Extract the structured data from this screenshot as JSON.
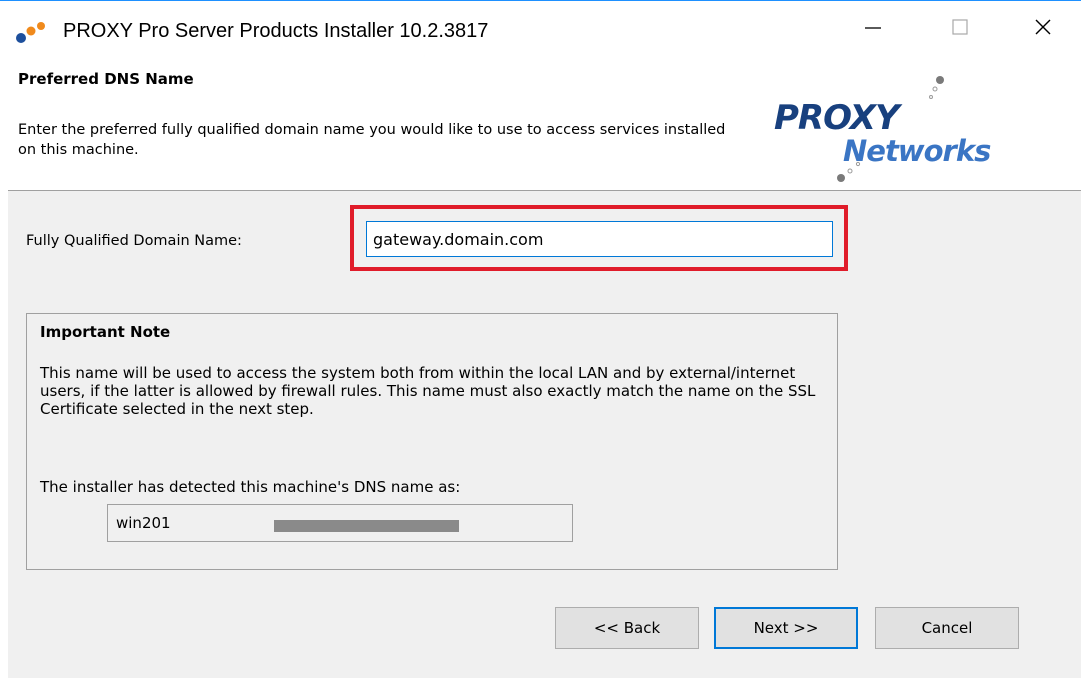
{
  "window": {
    "title": "PROXY Pro Server Products Installer 10.2.3817",
    "icon": "app-icon",
    "controls": [
      "minimize-icon",
      "maximize-icon",
      "close-icon"
    ]
  },
  "header": {
    "title": "Preferred DNS Name",
    "description": "Enter the preferred fully qualified domain name you would like to use to access services installed on this machine.",
    "logo": {
      "line1": "PROXY",
      "line2": "Networks"
    }
  },
  "form": {
    "fqdn_label": "Fully Qualified Domain Name:",
    "fqdn_value": "gateway.domain.com"
  },
  "note": {
    "title": "Important Note",
    "body": "This name will be used to access the system both from within the local LAN and by external/internet users, if the latter is allowed by firewall rules.  This name must also exactly match the name on the SSL Certificate selected in the next step.",
    "detected_label": "The installer has detected this machine's DNS name as:",
    "detected_value": "win201"
  },
  "buttons": {
    "back": "<< Back",
    "next": "Next >>",
    "cancel": "Cancel"
  },
  "colors": {
    "highlight": "#e01c2a",
    "accent": "#0078d7",
    "logo_dark": "#18407e",
    "logo_light": "#3a75c4"
  }
}
